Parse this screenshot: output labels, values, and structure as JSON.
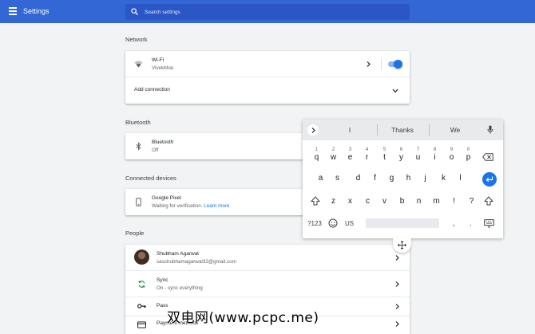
{
  "app": {
    "title": "Settings"
  },
  "search": {
    "placeholder": "Search settings"
  },
  "network": {
    "title": "Network",
    "wifi_label": "Wi-Fi",
    "wifi_network": "Vivekbhai",
    "wifi_enabled": true,
    "add_connection": "Add connection"
  },
  "bluetooth": {
    "title": "Bluetooth",
    "label": "Bluetooth",
    "status": "Off"
  },
  "connected_devices": {
    "title": "Connected devices",
    "device_name": "Google Pixel",
    "device_status": "Waiting for verification.",
    "learn_more": "Learn more"
  },
  "people": {
    "title": "People",
    "user_name": "Shubham Agarwal",
    "user_email": "sasshubhamagarwal32@gmail.com",
    "sync_label": "Sync",
    "sync_status": "On - sync everything",
    "passwords_partial": "Pass",
    "payment_methods": "Payment methods"
  },
  "keyboard": {
    "suggestions": [
      "I",
      "Thanks",
      "We"
    ],
    "row1": [
      {
        "key": "q",
        "hint": "1"
      },
      {
        "key": "w",
        "hint": "2"
      },
      {
        "key": "e",
        "hint": "3"
      },
      {
        "key": "r",
        "hint": "4"
      },
      {
        "key": "t",
        "hint": "5"
      },
      {
        "key": "y",
        "hint": "6"
      },
      {
        "key": "u",
        "hint": "7"
      },
      {
        "key": "i",
        "hint": "8"
      },
      {
        "key": "o",
        "hint": "9"
      },
      {
        "key": "p",
        "hint": "0"
      }
    ],
    "row2": [
      "a",
      "s",
      "d",
      "f",
      "g",
      "h",
      "j",
      "k",
      "l"
    ],
    "row3": [
      "z",
      "x",
      "c",
      "v",
      "b",
      "n",
      "m",
      "!",
      "?"
    ],
    "symbols_label": "?123",
    "language_label": "US",
    "comma": ",",
    "period": ".",
    "accent_color": "#1a73e8"
  },
  "watermark": {
    "text": "双电网(www.pcpc.me)"
  }
}
